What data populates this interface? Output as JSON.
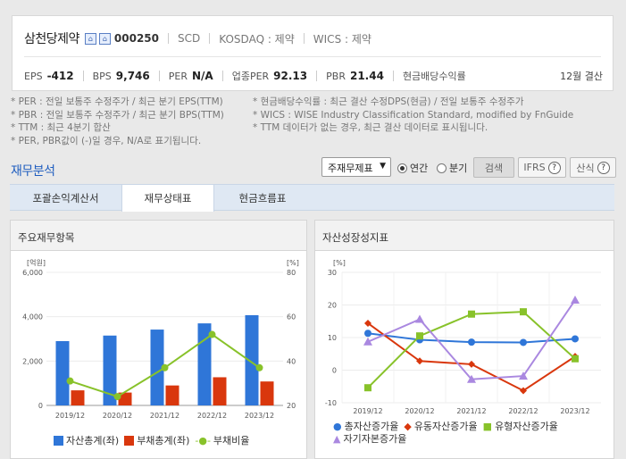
{
  "header": {
    "company": "삼천당제약",
    "code": "000250",
    "tags": [
      "SCD",
      "KOSDAQ : 제약",
      "WICS : 제약"
    ],
    "metrics": [
      {
        "label": "EPS",
        "value": "-412"
      },
      {
        "label": "BPS",
        "value": "9,746"
      },
      {
        "label": "PER",
        "value": "N/A"
      },
      {
        "label": "업종PER",
        "value": "92.13"
      },
      {
        "label": "PBR",
        "value": "21.44"
      },
      {
        "label": "현금배당수익률",
        "value": ""
      }
    ],
    "settlement": "12월 결산"
  },
  "notes_left": [
    "* PER : 전일 보통주 수정주가 / 최근 분기 EPS(TTM)",
    "* PBR : 전일 보통주 수정주가 / 최근 분기 BPS(TTM)",
    "* TTM : 최근 4분기 합산",
    "* PER, PBR값이 (-)일 경우, N/A로 표기됩니다."
  ],
  "notes_right": [
    "* 현금배당수익률 : 최근 결산 수정DPS(현금) / 전일 보통주 수정주가",
    "* WICS : WISE Industry Classification Standard, modified by FnGuide",
    "* TTM 데이터가 없는 경우, 최근 결산 데이터로 표시됩니다."
  ],
  "section": {
    "title": "재무분석",
    "select_value": "주재무제표",
    "radio_annual": "연간",
    "radio_quarter": "분기",
    "search_btn": "검색",
    "ifrs_btn": "IFRS",
    "formula_btn": "산식",
    "help_glyph": "?"
  },
  "tabs": [
    "포괄손익계산서",
    "재무상태표",
    "현금흐름표"
  ],
  "left_panel": {
    "title": "주요재무항목",
    "legend": [
      "자산총계(좌)",
      "부채총계(좌)",
      "부채비율"
    ]
  },
  "right_panel": {
    "title": "자산성장성지표",
    "legend": [
      "총자산증가율",
      "유동자산증가율",
      "유형자산증가율",
      "자기자본증가율"
    ]
  },
  "colors": {
    "asset": "#2f76d8",
    "debt": "#d9370d",
    "ratio": "#88c22a",
    "total_growth": "#2f76d8",
    "current_growth": "#d9370d",
    "tangible_growth": "#88c22a",
    "equity_growth": "#aa88e0"
  },
  "chart_data": [
    {
      "type": "bar",
      "title": "주요재무항목",
      "categories": [
        "2019/12",
        "2020/12",
        "2021/12",
        "2022/12",
        "2023/12"
      ],
      "y_left_unit": "[억원]",
      "y_right_unit": "[%]",
      "ylim_left": [
        0,
        6000
      ],
      "yticks_left": [
        "0",
        "2,000",
        "4,000",
        "6,000"
      ],
      "ylim_right": [
        20,
        80
      ],
      "yticks_right": [
        "20",
        "40",
        "60",
        "80"
      ],
      "series": [
        {
          "name": "자산총계(좌)",
          "axis": "left",
          "type": "bar",
          "values": [
            2900,
            3150,
            3420,
            3700,
            4070
          ]
        },
        {
          "name": "부채총계(좌)",
          "axis": "left",
          "type": "bar",
          "values": [
            680,
            580,
            900,
            1270,
            1080
          ]
        },
        {
          "name": "부채비율",
          "axis": "right",
          "type": "line",
          "values": [
            31,
            24,
            37,
            52,
            37
          ]
        }
      ]
    },
    {
      "type": "line",
      "title": "자산성장성지표",
      "categories": [
        "2019/12",
        "2020/12",
        "2021/12",
        "2022/12",
        "2023/12"
      ],
      "y_unit": "[%]",
      "ylim": [
        -10,
        30
      ],
      "yticks": [
        "-10",
        "0",
        "10",
        "20",
        "30"
      ],
      "series": [
        {
          "name": "총자산증가율",
          "values": [
            11.3,
            9.3,
            8.6,
            8.5,
            9.6
          ]
        },
        {
          "name": "유동자산증가율",
          "values": [
            14.4,
            2.8,
            1.8,
            -6.3,
            4.2
          ]
        },
        {
          "name": "유형자산증가율",
          "values": [
            -5.4,
            10.5,
            17.2,
            17.9,
            3.5
          ]
        },
        {
          "name": "자기자본증가율",
          "values": [
            8.7,
            15.6,
            -2.8,
            -1.8,
            21.5
          ]
        }
      ]
    }
  ]
}
